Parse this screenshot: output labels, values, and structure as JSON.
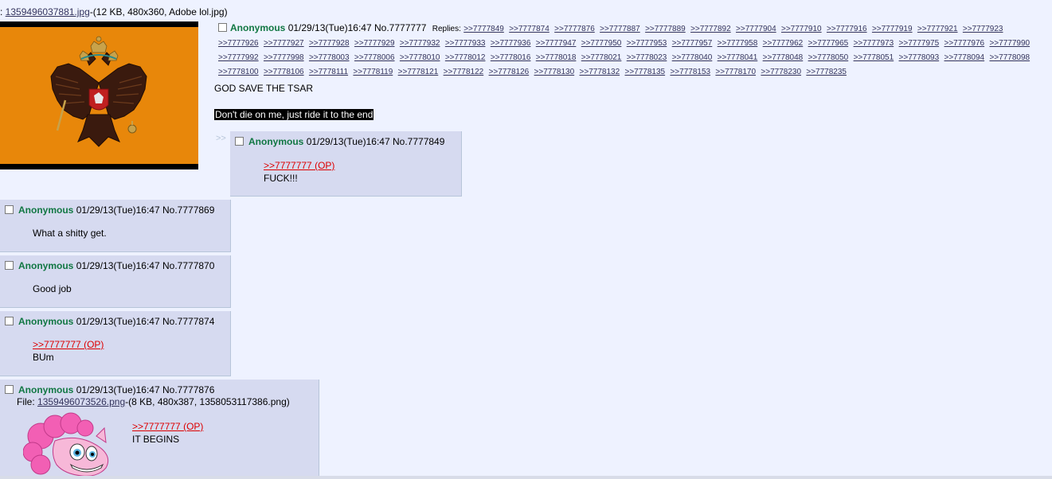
{
  "op": {
    "file_prefix": ": ",
    "file_name": "1359496037881.jpg",
    "file_meta": "-(12 KB, 480x360, Adobe lol.jpg)",
    "name": "Anonymous",
    "datetime": "01/29/13(Tue)16:47",
    "number": "No.7777777",
    "replies_label": "Replies:",
    "replies": [
      ">>7777849",
      ">>7777874",
      ">>7777876",
      ">>7777887",
      ">>7777889",
      ">>7777892",
      ">>7777904",
      ">>7777910",
      ">>7777916",
      ">>7777919",
      ">>7777921",
      ">>7777923",
      ">>7777926",
      ">>7777927",
      ">>7777928",
      ">>7777929",
      ">>7777932",
      ">>7777933",
      ">>7777936",
      ">>7777947",
      ">>7777950",
      ">>7777953",
      ">>7777957",
      ">>7777958",
      ">>7777962",
      ">>7777965",
      ">>7777973",
      ">>7777975",
      ">>7777976",
      ">>7777990",
      ">>7777992",
      ">>7777998",
      ">>7778003",
      ">>7778006",
      ">>7778010",
      ">>7778012",
      ">>7778016",
      ">>7778018",
      ">>7778021",
      ">>7778023",
      ">>7778040",
      ">>7778041",
      ">>7778048",
      ">>7778050",
      ">>7778051",
      ">>7778093",
      ">>7778094",
      ">>7778098",
      ">>7778100",
      ">>7778106",
      ">>7778111",
      ">>7778119",
      ">>7778121",
      ">>7778122",
      ">>7778126",
      ">>7778130",
      ">>7778132",
      ">>7778135",
      ">>7778153",
      ">>7778170",
      ">>7778230",
      ">>7778235"
    ],
    "body": "GOD SAVE THE TSAR",
    "spoiler": "Don't die on me, just ride it to the end",
    "thumb_icon": "double-headed-eagle-flag"
  },
  "side_arrow": ">>",
  "posts": [
    {
      "name": "Anonymous",
      "datetime": "01/29/13(Tue)16:47",
      "number": "No.7777849",
      "quote": ">>7777777 (OP)",
      "text": "FUCK!!!"
    },
    {
      "name": "Anonymous",
      "datetime": "01/29/13(Tue)16:47",
      "number": "No.7777869",
      "text": "What a shitty get."
    },
    {
      "name": "Anonymous",
      "datetime": "01/29/13(Tue)16:47",
      "number": "No.7777870",
      "text": "Good job"
    },
    {
      "name": "Anonymous",
      "datetime": "01/29/13(Tue)16:47",
      "number": "No.7777874",
      "quote": ">>7777777 (OP)",
      "text": "BUm"
    },
    {
      "name": "Anonymous",
      "datetime": "01/29/13(Tue)16:47",
      "number": "No.7777876",
      "file_label": "File: ",
      "file_name": "1359496073526.png",
      "file_meta": "-(8 KB, 480x387, 1358053117386.png)",
      "quote": ">>7777777 (OP)",
      "text": "IT BEGINS",
      "thumb_icon": "pink-pony-thumbnail"
    }
  ],
  "colors": {
    "background": "#eef2ff",
    "reply_bg": "#d6daf0",
    "name": "#117743",
    "quote": "#dd0000",
    "flag_orange": "#e8870a"
  }
}
